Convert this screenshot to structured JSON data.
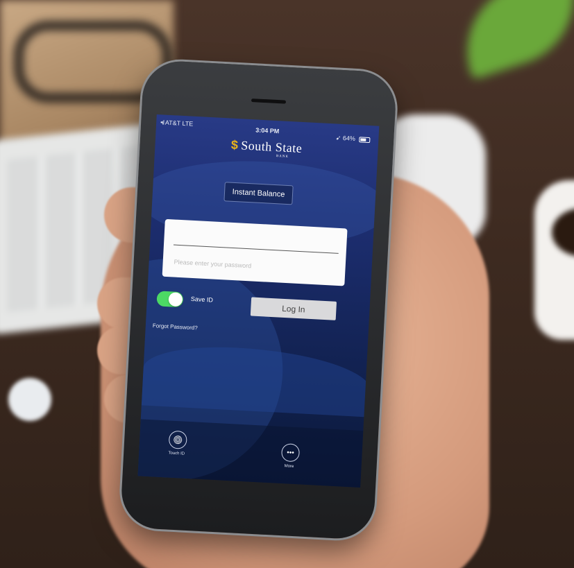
{
  "status_bar": {
    "carrier": "AT&T  LTE",
    "time": "3:04 PM",
    "battery": "64%"
  },
  "brand": {
    "mark": "$",
    "name": "South State",
    "sub": "BANK"
  },
  "instant_balance_label": "Instant Balance",
  "login_form": {
    "username_value": "",
    "password_placeholder": "Please enter your password"
  },
  "save_id": {
    "label": "Save ID",
    "enabled": true
  },
  "login_button_label": "Log In",
  "forgot_password_label": "Forgot Password?",
  "bottom_bar": {
    "touch_id_label": "Touch ID",
    "touch_id_icon": "fingerprint-icon",
    "more_label": "More",
    "more_icon": "more-dots-icon"
  },
  "colors": {
    "toggle_on": "#4cd964",
    "brand_gold": "#e8b21a",
    "screen_blue": "#1c2d6e"
  }
}
